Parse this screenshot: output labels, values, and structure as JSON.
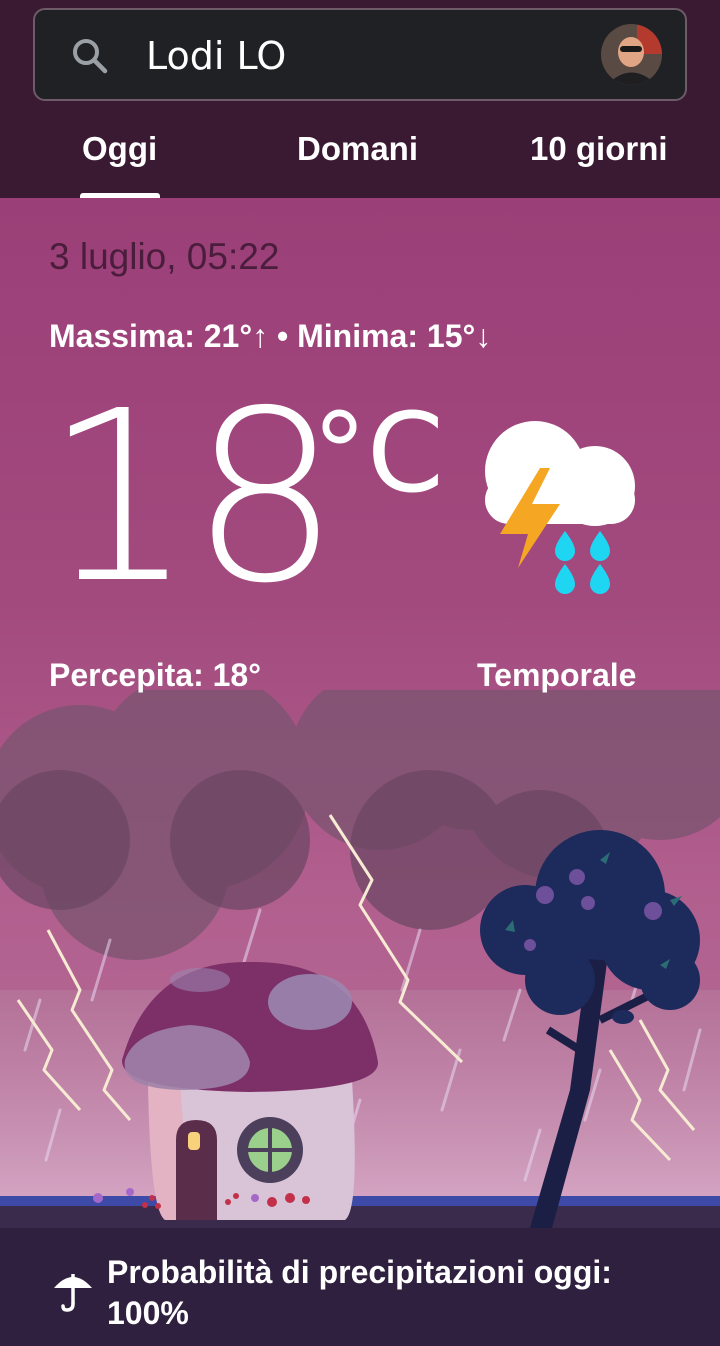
{
  "search": {
    "location": "Lodi LO"
  },
  "tabs": [
    {
      "label": "Oggi",
      "selected": true
    },
    {
      "label": "Domani",
      "selected": false
    },
    {
      "label": "10 giorni",
      "selected": false
    }
  ],
  "weather": {
    "datetime": "3 luglio, 05:22",
    "hilo": "Massima: 21°↑ • Minima: 15°↓",
    "temperature": "18",
    "unit": "°C",
    "feels_like": "Percepita: 18°",
    "condition": "Temporale",
    "condition_icon": "thunderstorm-rain-icon",
    "precipitation": "Probabilità di precipitazioni oggi: 100%"
  },
  "colors": {
    "top_bar": "#3a1a32",
    "background": "#a24a7e",
    "date_text": "#4a1d3c",
    "lightning": "#f5a623",
    "rain_drop": "#1fd6f2"
  },
  "icons": {
    "search": "search-icon",
    "avatar": "avatar",
    "umbrella": "umbrella-icon"
  }
}
